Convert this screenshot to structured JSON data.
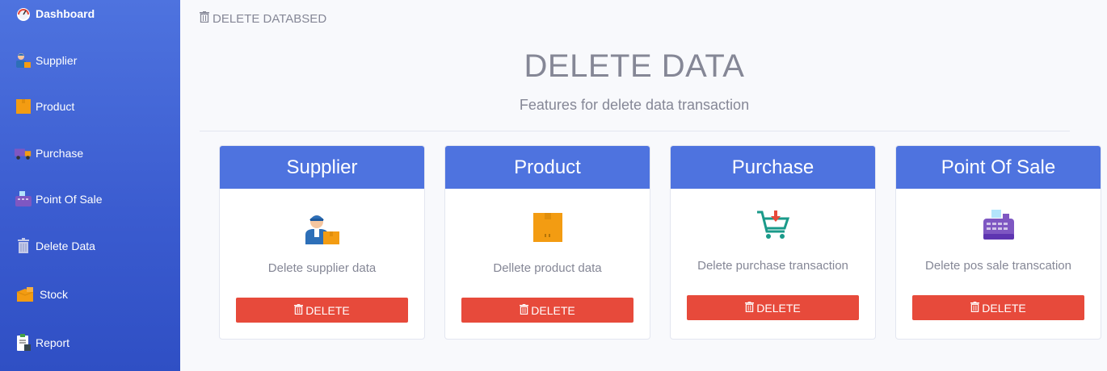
{
  "sidebar": {
    "items": [
      {
        "label": "Dashboard",
        "icon": "speedometer-icon"
      },
      {
        "label": "Supplier",
        "icon": "supplier-person-icon"
      },
      {
        "label": "Product",
        "icon": "box-icon"
      },
      {
        "label": "Purchase",
        "icon": "truck-icon"
      },
      {
        "label": "Point Of Sale",
        "icon": "cash-register-icon"
      },
      {
        "label": "Delete Data",
        "icon": "trash-icon"
      },
      {
        "label": "Stock",
        "icon": "boxes-icon"
      },
      {
        "label": "Report",
        "icon": "clipboard-icon"
      }
    ]
  },
  "breadcrumb": {
    "text": "DELETE DATABSED"
  },
  "header": {
    "title": "DELETE DATA",
    "subtitle": "Features for delete data transaction"
  },
  "cards": [
    {
      "title": "Supplier",
      "desc": "Delete supplier data",
      "button": "DELETE",
      "icon": "supplier-person-icon"
    },
    {
      "title": "Product",
      "desc": "Dellete product data",
      "button": "DELETE",
      "icon": "box-icon"
    },
    {
      "title": "Purchase",
      "desc": "Delete purchase transaction",
      "button": "DELETE",
      "icon": "cart-icon"
    },
    {
      "title": "Point Of Sale",
      "desc": "Delete pos sale transcation",
      "button": "DELETE",
      "icon": "cash-register-icon"
    }
  ],
  "colors": {
    "primary": "#4e73df",
    "danger": "#e74a3b",
    "muted": "#858796"
  }
}
